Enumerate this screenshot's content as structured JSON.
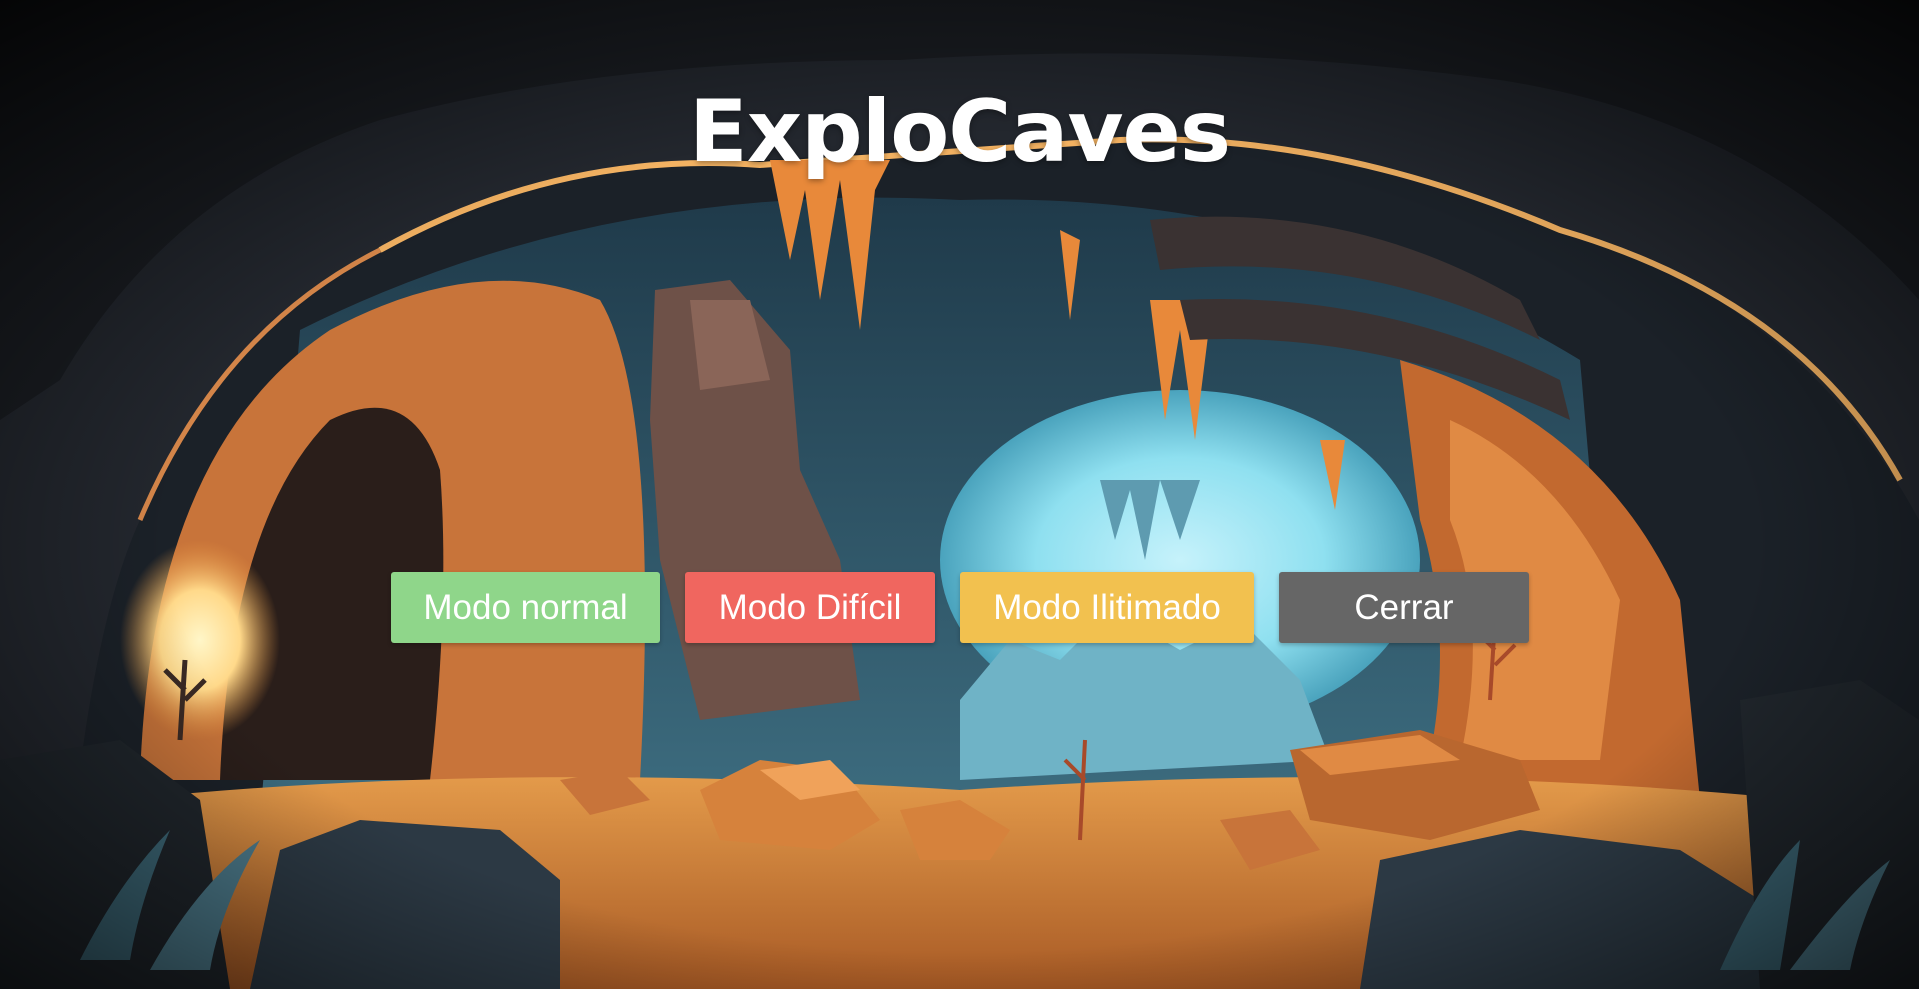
{
  "game": {
    "title": "ExploCaves"
  },
  "menu": {
    "buttons": [
      {
        "label": "Modo normal",
        "color": "#8fd68a"
      },
      {
        "label": "Modo Difícil",
        "color": "#f0665f"
      },
      {
        "label": "Modo Ilitimado",
        "color": "#f2c14f"
      },
      {
        "label": "Cerrar",
        "color": "#666666"
      }
    ]
  },
  "background": {
    "scene": "cave-illustration",
    "colors": {
      "cave_dark": "#1b2128",
      "rock_warm": "#c8743a",
      "glow": "#ffe9a8",
      "sky": "#8fe0f0",
      "floor": "#d98a3c"
    }
  }
}
